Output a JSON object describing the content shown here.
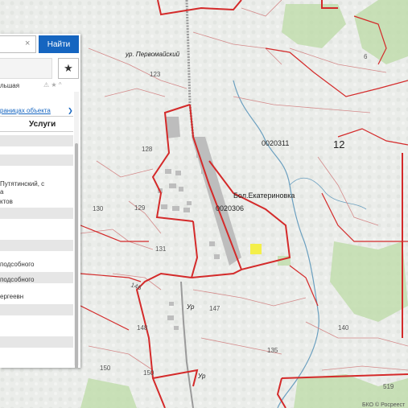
{
  "search": {
    "placeholder": "",
    "clear_icon": "×",
    "button_label": "Найти"
  },
  "panel": {
    "star_icon": "star-icon",
    "warn_icons": "⚠ ★ ^",
    "row_text_1": "льшая",
    "link_text": "раницах объекта",
    "link_arrow": "❯",
    "header_label": "Услуги",
    "rows": [
      {
        "text": ""
      },
      {
        "text": ""
      },
      {
        "text": "Путятинский, с"
      },
      {
        "text": "а"
      },
      {
        "text": "ктов"
      },
      {
        "text": ""
      },
      {
        "text": ""
      },
      {
        "text": "подсобного"
      },
      {
        "text": "подсобного"
      },
      {
        "text": "ергеевн"
      }
    ]
  },
  "map": {
    "labels": {
      "street_top": "ур. Первомайский",
      "village": "Бол.Екатериновка",
      "q_0020311": "0020311",
      "q_0020306": "0020306",
      "n12": "12",
      "n6": "6",
      "n123": "123",
      "n128": "128",
      "n129": "129",
      "n130": "130",
      "n131": "131",
      "n146": "146",
      "n147": "147",
      "n148": "148",
      "n150": "150",
      "n150b": "150",
      "n135": "135",
      "n140": "140",
      "n519": "519",
      "ur1": "Ур",
      "ur2": "Ур",
      "copyright": "БКО © Росреест"
    },
    "colors": {
      "boundary": "#d42a2a",
      "road": "#9a9a9a",
      "river": "#6a9fbf",
      "green": "#b9d8a4"
    }
  }
}
